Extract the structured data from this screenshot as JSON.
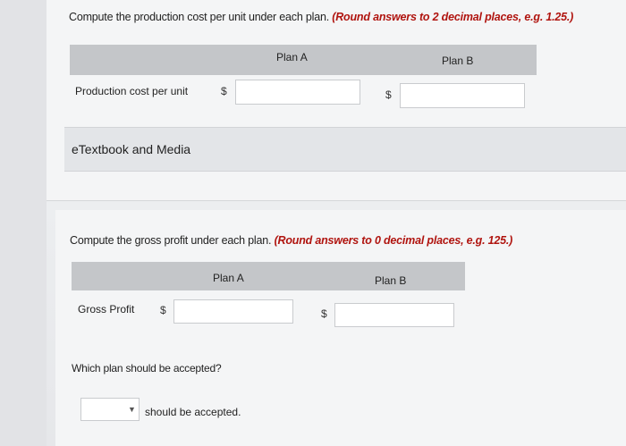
{
  "section1": {
    "question_text": "Compute the production cost per unit under each plan.",
    "hint_text": "(Round answers to 2 decimal places, e.g. 1.25.)",
    "col_a": "Plan A",
    "col_b": "Plan B",
    "row_label": "Production cost per unit",
    "currency_a": "$",
    "currency_b": "$",
    "value_a": "",
    "value_b": ""
  },
  "etextbook": {
    "label": "eTextbook and Media"
  },
  "section2": {
    "question_text": "Compute the gross profit under each plan.",
    "hint_text": "(Round answers to 0 decimal places, e.g. 125.)",
    "col_a": "Plan A",
    "col_b": "Plan B",
    "row_label": "Gross Profit",
    "currency_a": "$",
    "currency_b": "$",
    "value_a": "",
    "value_b": ""
  },
  "section3": {
    "question_text": "Which plan should be accepted?",
    "selected_value": "",
    "suffix_text": "should be accepted."
  }
}
